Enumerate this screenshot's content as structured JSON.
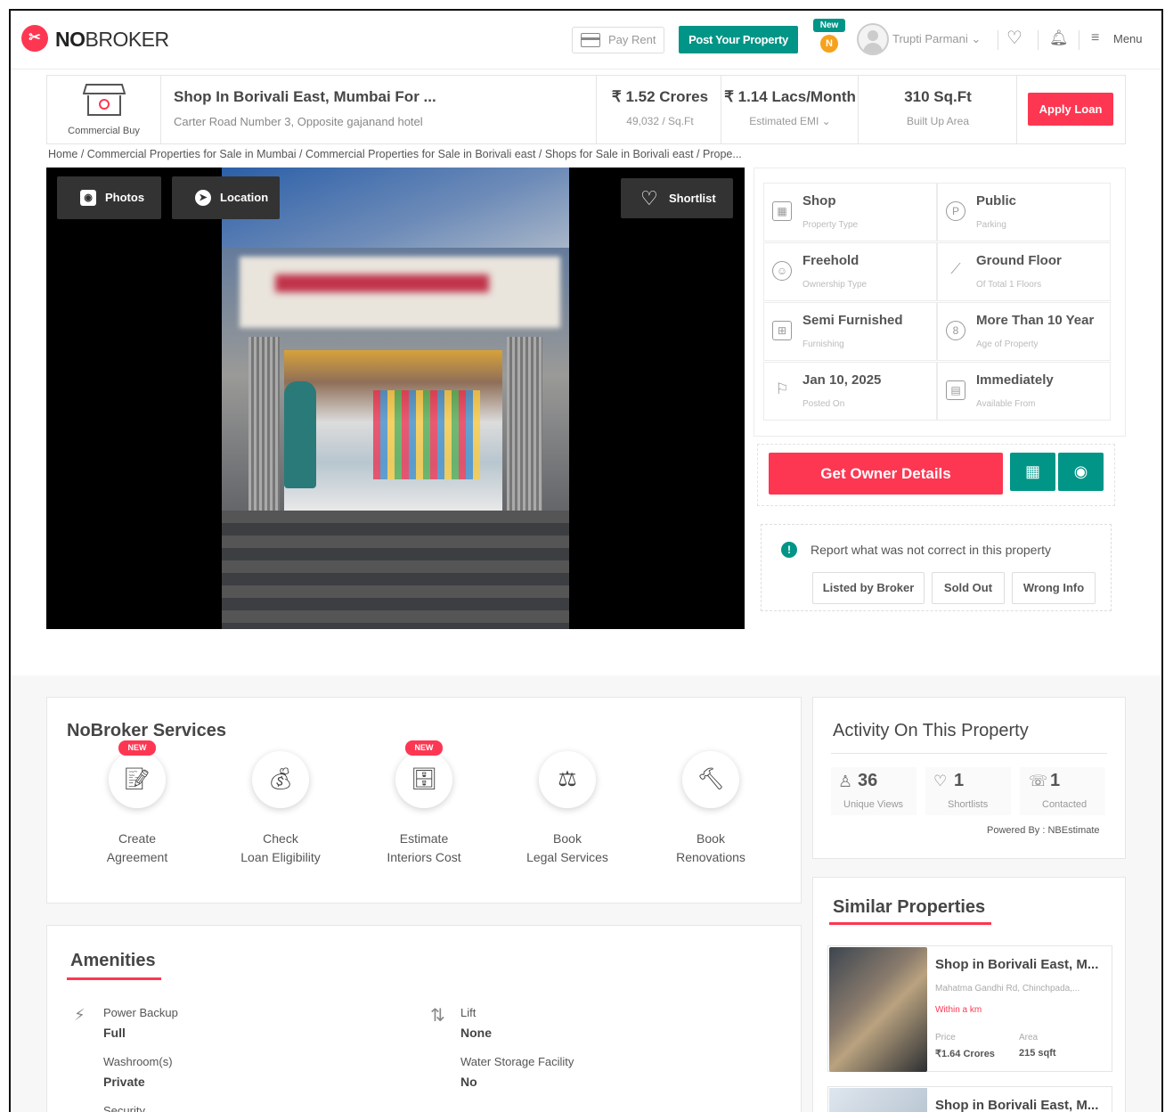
{
  "header": {
    "brand_prefix": "NO",
    "brand_suffix": "BROKER",
    "pay_rent": "Pay Rent",
    "post_property": "Post Your Property",
    "new_badge": "New",
    "coin_letter": "N",
    "user_name": "Trupti Parmani",
    "menu": "Menu",
    "accent": "#fd3752",
    "teal": "#009587"
  },
  "summary": {
    "category": "Commercial Buy",
    "title": "Shop In Borivali East, Mumbai For ...",
    "address": "Carter Road Number 3, Opposite gajanand hotel",
    "price": "₹ 1.52 Crores",
    "price_per_sqft": "49,032 / Sq.Ft",
    "emi": "₹ 1.14 Lacs/Month",
    "emi_label": "Estimated EMI",
    "area": "310 Sq.Ft",
    "area_label": "Built Up Area",
    "apply_loan": "Apply Loan"
  },
  "breadcrumb": "Home / Commercial Properties for Sale in Mumbai / Commercial Properties for Sale in Borivali east / Shops for Sale in Borivali east / Prope...",
  "gallery": {
    "photos": "Photos",
    "location": "Location",
    "shortlist": "Shortlist"
  },
  "specs": [
    {
      "value": "Shop",
      "label": "Property Type",
      "icon": "building-icon"
    },
    {
      "value": "Public",
      "label": "Parking",
      "icon": "parking-icon"
    },
    {
      "value": "Freehold",
      "label": "Ownership Type",
      "icon": "owner-icon"
    },
    {
      "value": "Ground Floor",
      "label": "Of Total 1 Floors",
      "icon": "stairs-icon"
    },
    {
      "value": "Semi Furnished",
      "label": "Furnishing",
      "icon": "furnishing-icon"
    },
    {
      "value": "More Than 10 Year",
      "label": "Age of Property",
      "icon": "age-icon"
    },
    {
      "value": "Jan 10, 2025",
      "label": "Posted On",
      "icon": "flag-icon"
    },
    {
      "value": "Immediately",
      "label": "Available From",
      "icon": "calendar-icon"
    }
  ],
  "owner_button": "Get Owner Details",
  "report": {
    "text": "Report what was not correct in this property",
    "options": [
      "Listed by Broker",
      "Sold Out",
      "Wrong Info"
    ]
  },
  "services": {
    "title": "NoBroker Services",
    "items": [
      {
        "label": "Create\nAgreement",
        "badge": "NEW",
        "icon": "agreement-icon"
      },
      {
        "label": "Check\nLoan Eligibility",
        "badge": "",
        "icon": "loan-icon"
      },
      {
        "label": "Estimate\nInteriors Cost",
        "badge": "NEW",
        "icon": "interiors-icon"
      },
      {
        "label": "Book\nLegal Services",
        "badge": "",
        "icon": "legal-icon"
      },
      {
        "label": "Book\nRenovations",
        "badge": "",
        "icon": "renovation-icon"
      }
    ]
  },
  "amenities": {
    "title": "Amenities",
    "items": [
      {
        "name": "Power Backup",
        "value": "Full"
      },
      {
        "name": "Lift",
        "value": "None"
      },
      {
        "name": "Washroom(s)",
        "value": "Private"
      },
      {
        "name": "Water Storage Facility",
        "value": "No"
      },
      {
        "name": "Security",
        "value": ""
      }
    ]
  },
  "activity": {
    "title": "Activity On This Property",
    "stats": [
      {
        "value": "36",
        "label": "Unique Views"
      },
      {
        "value": "1",
        "label": "Shortlists"
      },
      {
        "value": "1",
        "label": "Contacted"
      }
    ],
    "powered_by": "Powered By : NBEstimate"
  },
  "similar": {
    "title": "Similar Properties",
    "items": [
      {
        "title": "Shop in Borivali East, M...",
        "address": "Mahatma Gandhi Rd, Chinchpada,...",
        "distance": "Within a km",
        "price_label": "Price",
        "price": "₹1.64 Crores",
        "area_label": "Area",
        "area": "215 sqft"
      },
      {
        "title": "Shop in Borivali East, M..."
      }
    ]
  }
}
